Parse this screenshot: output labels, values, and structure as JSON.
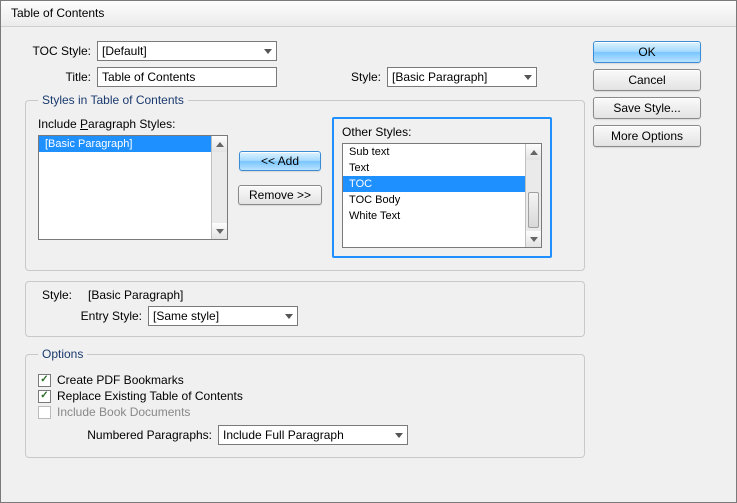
{
  "window": {
    "title": "Table of Contents"
  },
  "top": {
    "tocStyleLabel": "TOC Style:",
    "tocStyleValue": "[Default]",
    "titleLabel": "Title:",
    "titleValue": "Table of Contents",
    "styleLabel": "Style:",
    "styleValue": "[Basic Paragraph]"
  },
  "buttons": {
    "ok": "OK",
    "cancel": "Cancel",
    "saveStyle": "Save Style...",
    "moreOptions": "More Options",
    "add": "<< Add",
    "remove": "Remove >>"
  },
  "stylesGroup": {
    "legend": "Styles in Table of Contents",
    "includeLabelPre": "Include ",
    "includeLabelU": "P",
    "includeLabelPost": "aragraph Styles:",
    "included": [
      "[Basic Paragraph]"
    ],
    "otherLabel": "Other Styles:",
    "other": [
      "Sub text",
      "Text",
      "TOC",
      "TOC Body",
      "White Text"
    ],
    "otherSelectedIndex": 2
  },
  "entry": {
    "styleLabel": "Style:",
    "styleValue": "[Basic Paragraph]",
    "entryStyleLabel": "Entry Style:",
    "entryStyleValue": "[Same style]"
  },
  "options": {
    "legend": "Options",
    "createPdf": {
      "label": "Create PDF Bookmarks",
      "checked": true
    },
    "replace": {
      "label": "Replace Existing Table of Contents",
      "checked": true
    },
    "includeBook": {
      "label": "Include Book Documents",
      "checked": false
    },
    "numberedLabel": "Numbered Paragraphs:",
    "numberedValue": "Include Full Paragraph"
  }
}
